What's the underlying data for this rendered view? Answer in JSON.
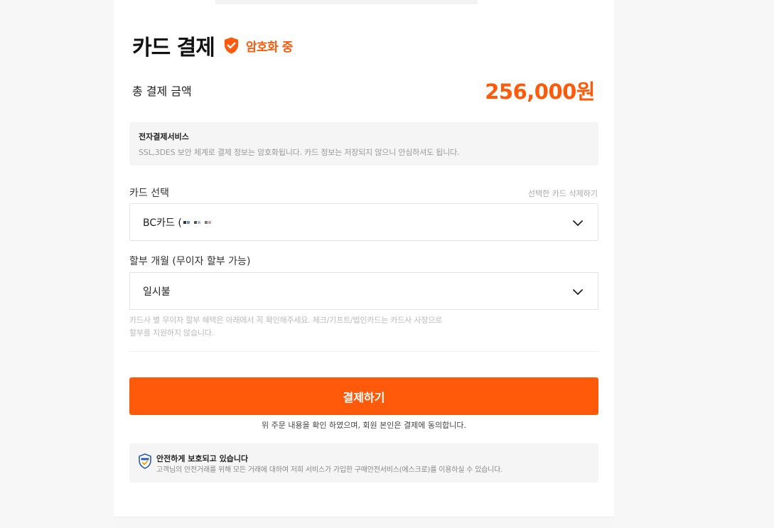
{
  "header": {
    "title": "카드 결제",
    "encryption_label": "암호화 중"
  },
  "total": {
    "label": "총 결제 금액",
    "amount": "256,000원"
  },
  "notice": {
    "title": "전자결제서비스",
    "text": "SSL,3DES 보안 체계로 결제 정보는 암호화됩니다. 카드 정보는 저장되지 않으니 안심하셔도 됩니다."
  },
  "card_select": {
    "label": "카드 선택",
    "delete_link": "선택한 카드 삭제하기",
    "value": "BC카드 ("
  },
  "installment": {
    "label": "할부 개월 (무이자 할부 가능)",
    "value": "일시불",
    "note_line1": "카드사 별 무이자 할부 혜택은 아래에서 꼭 확인해주세요. 체크/기프트/법인카드는 카드사 사정으로",
    "note_line2": "할부를 지원하지 않습니다."
  },
  "pay_button": {
    "label": "결제하기"
  },
  "agreement": {
    "text": "위 주문 내용을 확인 하였으며, 회원 본인은 결제에 동의합니다."
  },
  "secure": {
    "title": "안전하게 보호되고 있습니다",
    "text": "고객님의 안전거래를 위해 모든 거래에 대하여 저희 서비스가 가입한 구매안전서비스(에스크로)를 이용하실 수 있습니다."
  },
  "icons": {
    "shield": "shield-check-icon",
    "chevron": "chevron-down-icon",
    "secure": "escrow-badge-icon"
  },
  "colors": {
    "accent": "#ff5a0a",
    "panel": "#ffffff",
    "background": "#f7f7f7"
  }
}
